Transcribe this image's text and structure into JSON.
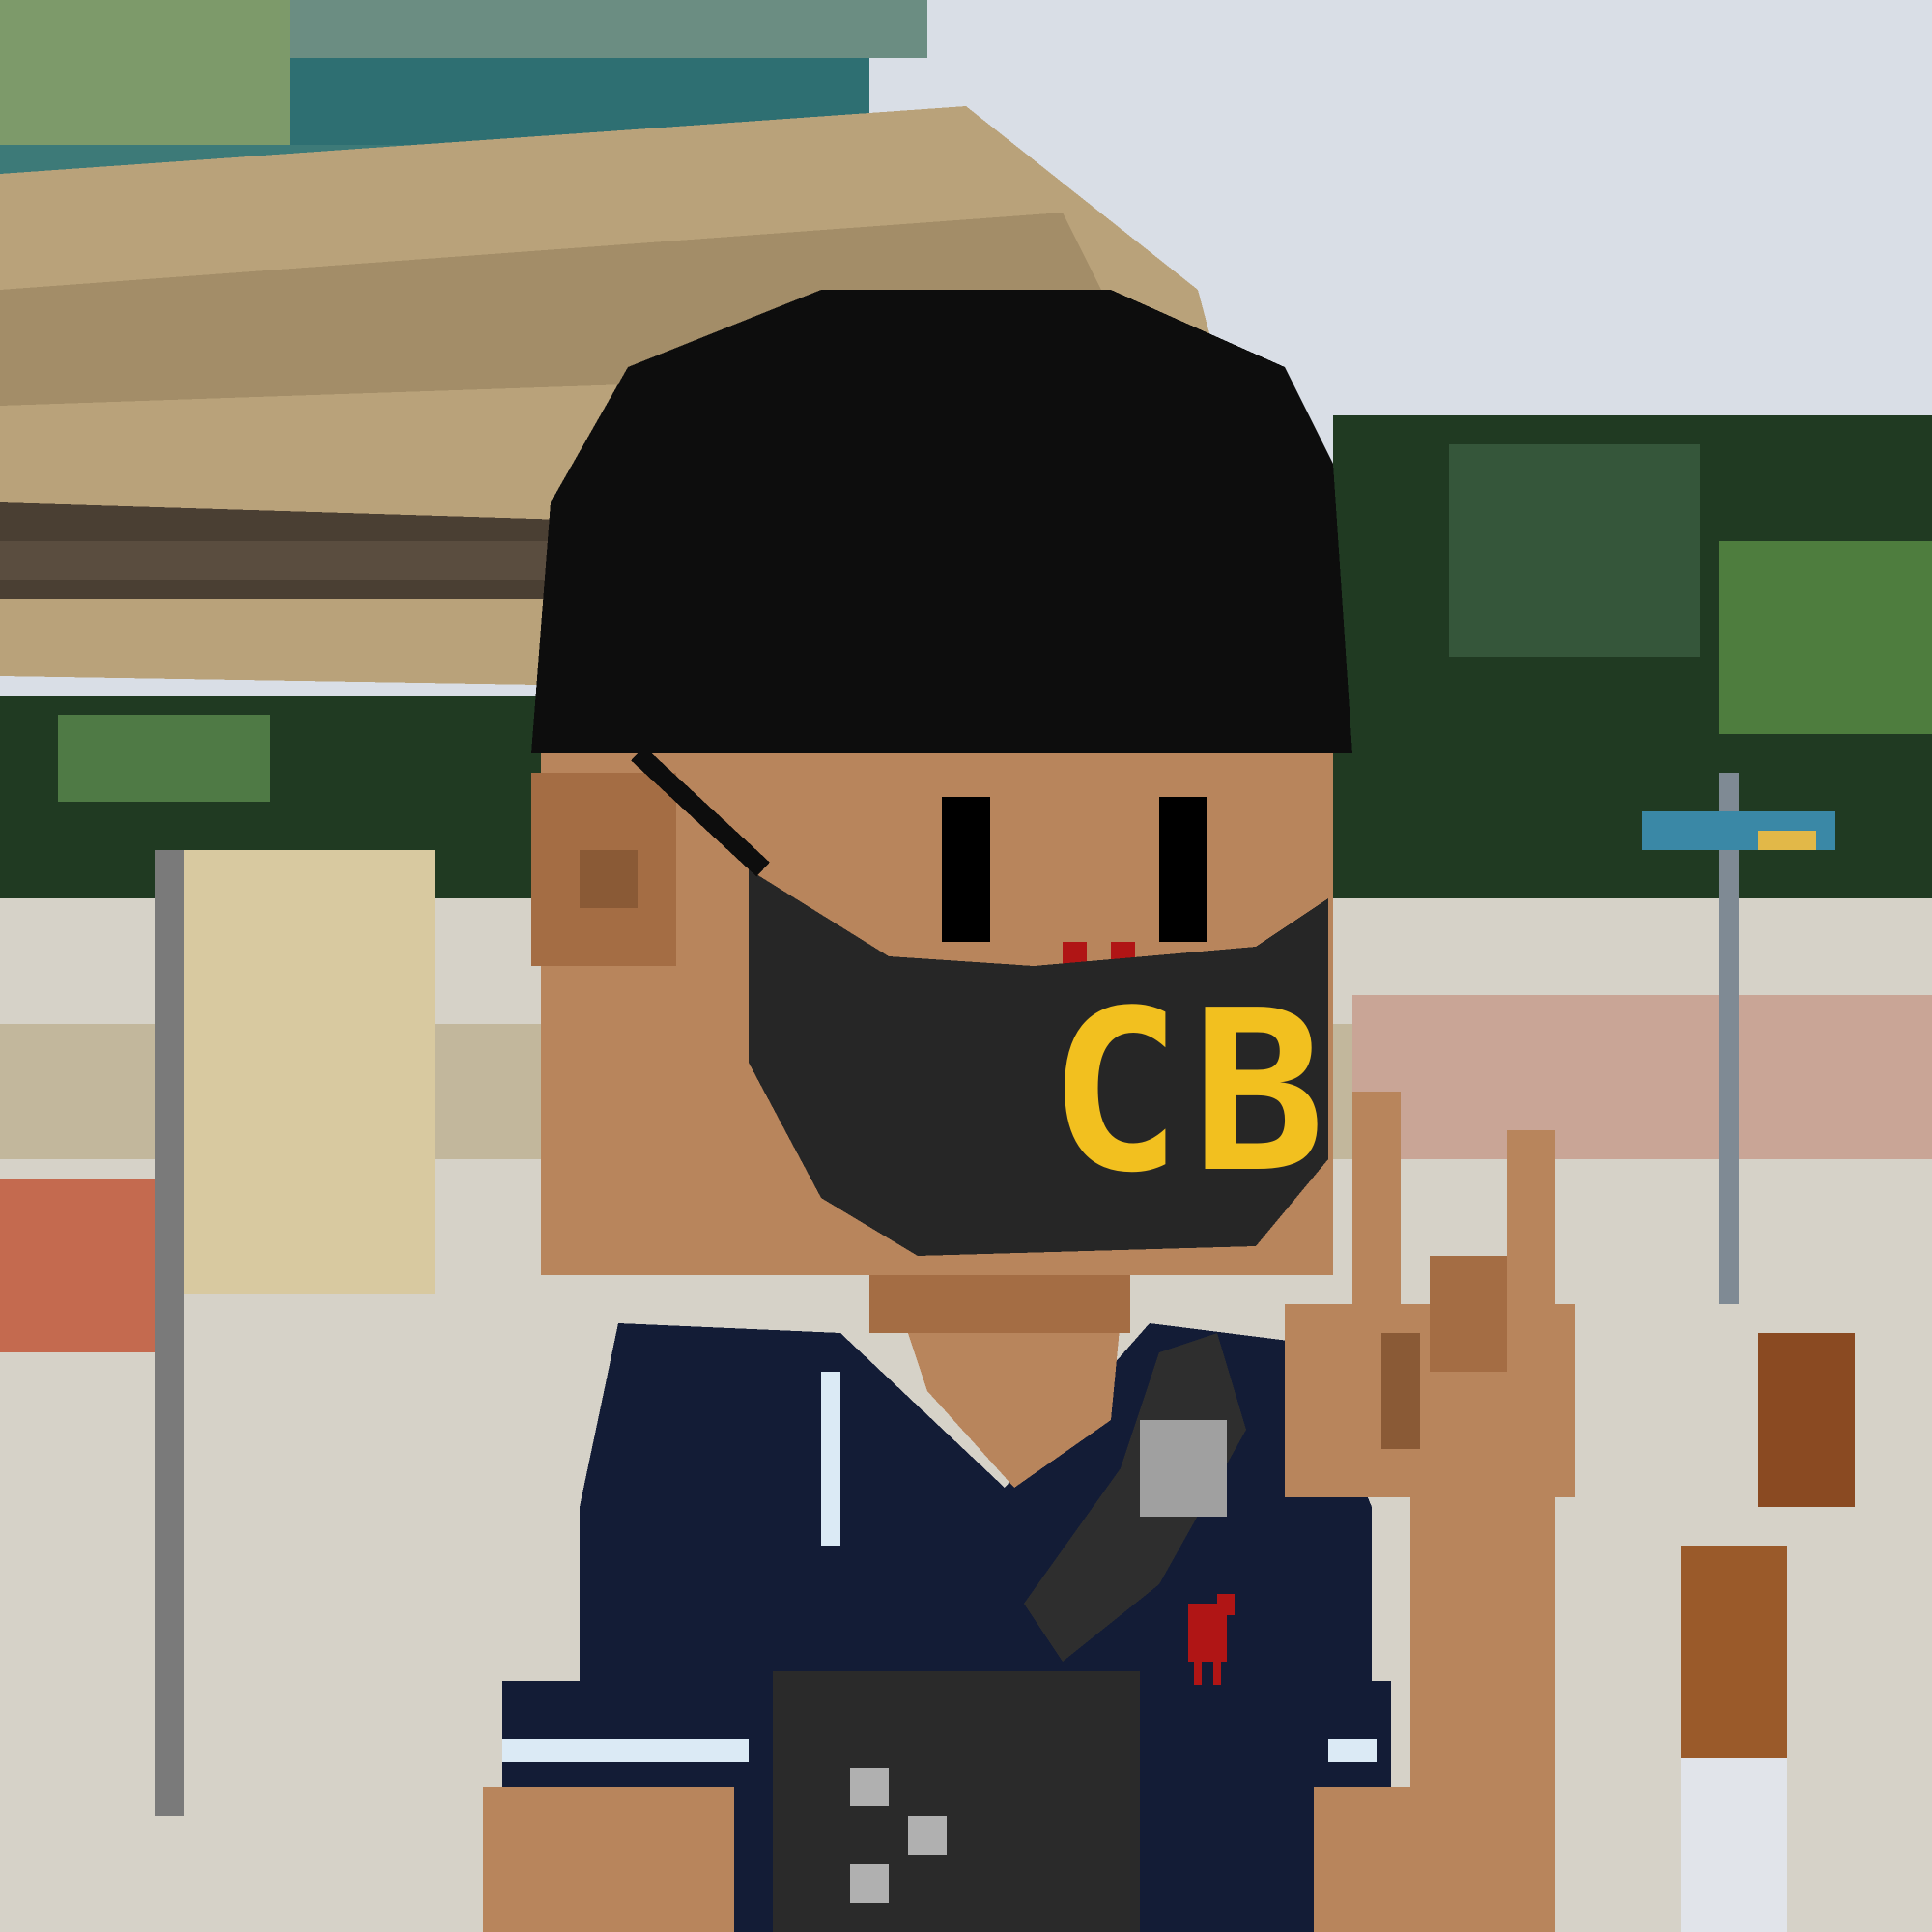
{
  "avatar": {
    "mask_text": "CB",
    "colors": {
      "sky": "#d9dee6",
      "hair": "#0d0d0d",
      "skin": "#b8855c",
      "skin_shadow": "#8a5a36",
      "mask": "#262626",
      "mask_text": "#f2c01f",
      "shirt": "#131c36",
      "shirt_stripe": "#dbeaf5",
      "strap": "#2e2e2e",
      "logo": "#b01515",
      "foliage": "#203a22",
      "awning": "#b9a27a"
    }
  }
}
